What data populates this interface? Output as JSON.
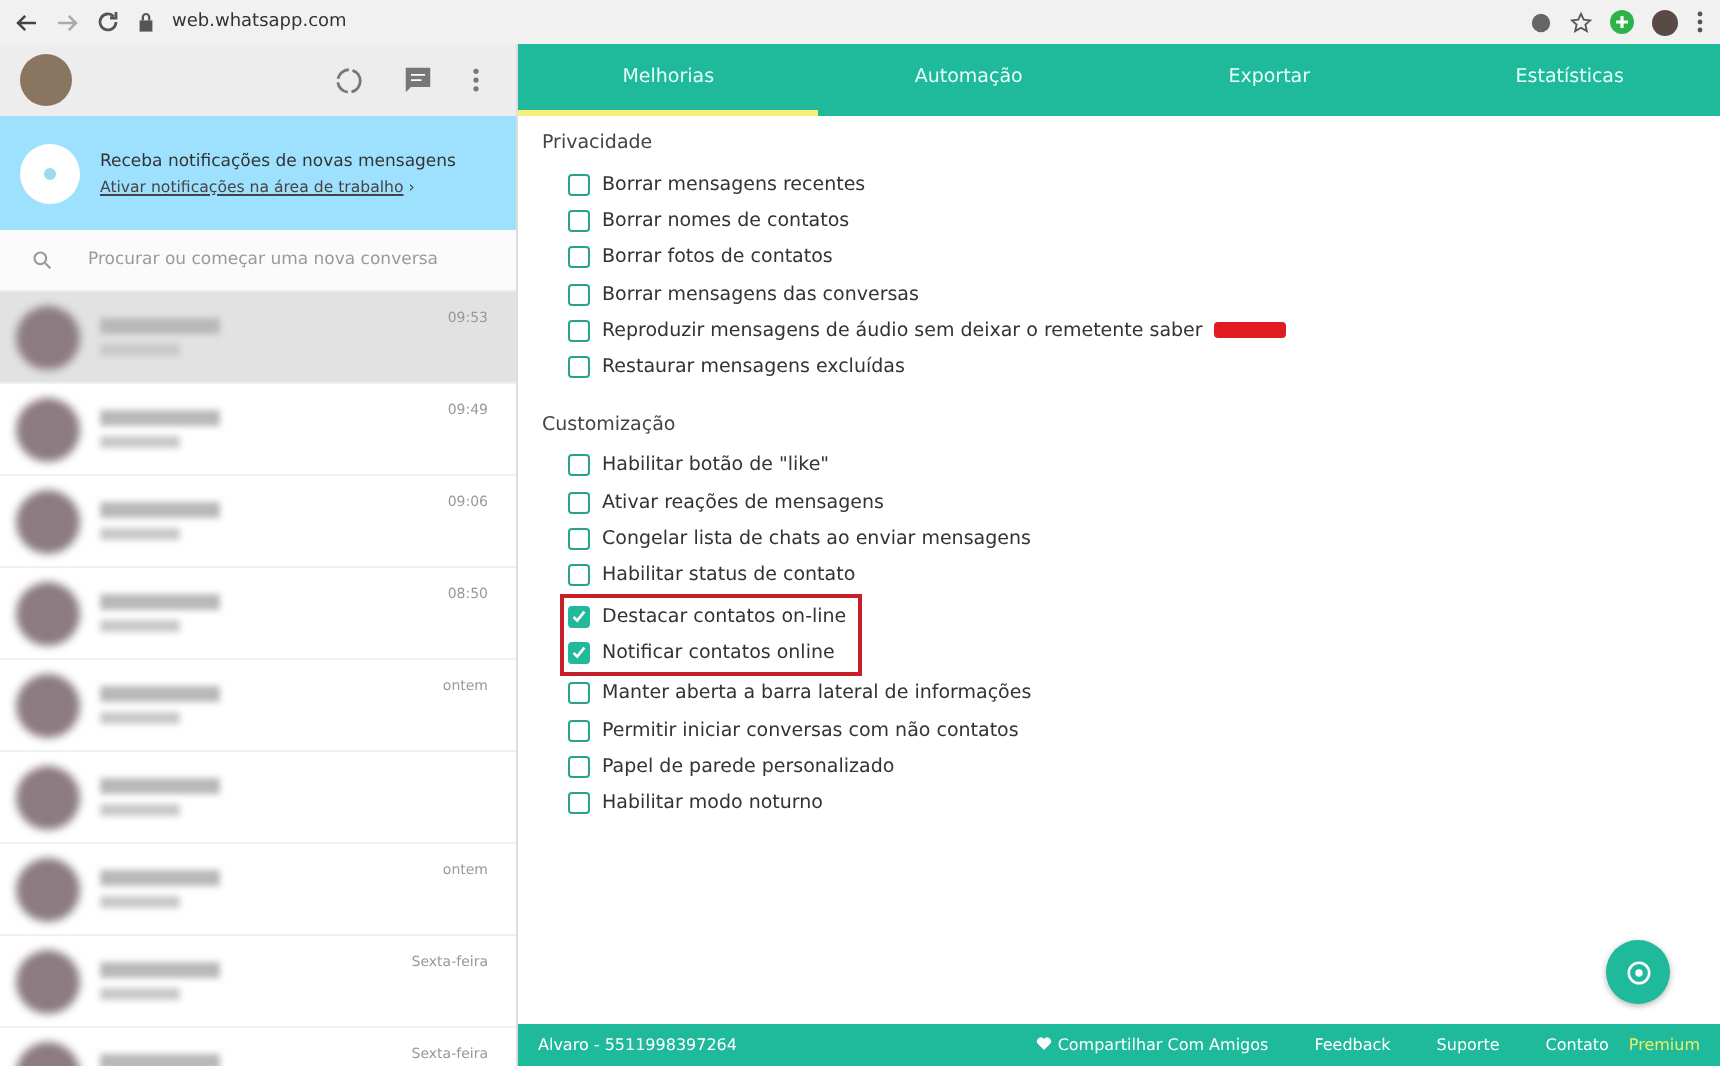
{
  "browser": {
    "url": "web.whatsapp.com"
  },
  "notification": {
    "title": "Receba notificações de novas mensagens",
    "link": "Ativar notificações na área de trabalho",
    "chevron": "›"
  },
  "search": {
    "placeholder": "Procurar ou começar uma nova conversa"
  },
  "chats": [
    {
      "time": "09:53",
      "selected": true
    },
    {
      "time": "09:49",
      "selected": false
    },
    {
      "time": "09:06",
      "selected": false
    },
    {
      "time": "08:50",
      "selected": false
    },
    {
      "time": "ontem",
      "selected": false
    },
    {
      "selected": false
    },
    {
      "time": "ontem",
      "selected": false
    },
    {
      "time": "Sexta-feira",
      "selected": false
    },
    {
      "time": "Sexta-feira",
      "selected": false
    }
  ],
  "tabs": [
    {
      "label": "Melhorias",
      "selected": true
    },
    {
      "label": "Automação",
      "selected": false
    },
    {
      "label": "Exportar",
      "selected": false
    },
    {
      "label": "Estatísticas",
      "selected": false
    }
  ],
  "sections": [
    {
      "title": "Privacidade",
      "options": [
        {
          "label": "Borrar mensagens recentes",
          "checked": false,
          "highlighted": false
        },
        {
          "label": "Borrar nomes de contatos",
          "checked": false,
          "highlighted": false
        },
        {
          "label": "Borrar fotos de contatos",
          "checked": false,
          "highlighted": false
        },
        {
          "label": "Borrar mensagens das conversas",
          "checked": false,
          "highlighted": false
        },
        {
          "label": "Reproduzir mensagens de áudio sem deixar o remetente saber",
          "checked": false,
          "highlighted": false,
          "tag": true
        },
        {
          "label": "Restaurar mensagens excluídas",
          "checked": false,
          "highlighted": false
        }
      ]
    },
    {
      "title": "Customização",
      "options": [
        {
          "label": "Habilitar botão de \"like\"",
          "checked": false,
          "highlighted": false
        },
        {
          "label": "Ativar reações de mensagens",
          "checked": false,
          "highlighted": false
        },
        {
          "label": "Congelar lista de chats ao enviar mensagens",
          "checked": false,
          "highlighted": false
        },
        {
          "label": "Habilitar status de contato",
          "checked": false,
          "highlighted": false
        },
        {
          "label": "Destacar contatos on-line",
          "checked": true,
          "highlighted": true
        },
        {
          "label": "Notificar contatos online",
          "checked": true,
          "highlighted": true
        },
        {
          "label": "Manter aberta a barra lateral de informações",
          "checked": false,
          "highlighted": false
        },
        {
          "label": "Permitir iniciar conversas com não contatos",
          "checked": false,
          "highlighted": false
        },
        {
          "label": "Papel de parede personalizado",
          "checked": false,
          "highlighted": false
        },
        {
          "label": "Habilitar modo noturno",
          "checked": false,
          "highlighted": false
        }
      ]
    }
  ],
  "footer": {
    "user": "Alvaro - 5511998397264",
    "links": [
      {
        "label": "Compartilhar Com Amigos",
        "kind": "share"
      },
      {
        "label": "Feedback",
        "kind": "plain"
      },
      {
        "label": "Suporte",
        "kind": "plain"
      },
      {
        "label": "Contato",
        "kind": "plain"
      },
      {
        "label": "Premium",
        "kind": "premium"
      }
    ]
  }
}
